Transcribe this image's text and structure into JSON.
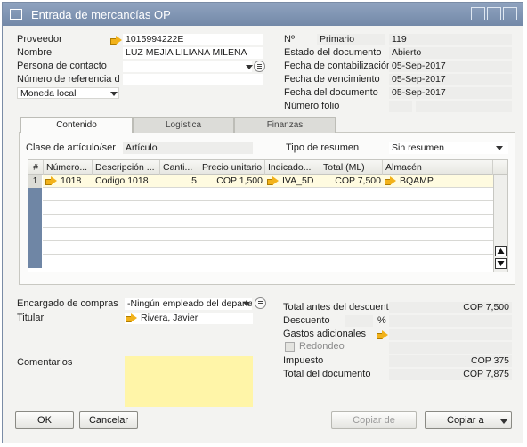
{
  "window": {
    "title": "Entrada de mercancías OP"
  },
  "header_left": {
    "proveedor_label": "Proveedor",
    "proveedor_value": "1015994222E",
    "nombre_label": "Nombre",
    "nombre_value": "LUZ MEJIA LILIANA MILENA",
    "persona_contacto_label": "Persona de contacto",
    "persona_contacto_value": "",
    "numero_referencia_label": "Número de referencia d",
    "numero_referencia_value": "",
    "moneda_value": "Moneda local"
  },
  "header_right": {
    "no_label": "Nº",
    "serie_value": "Primario",
    "no_value": "119",
    "estado_label": "Estado del documento",
    "estado_value": "Abierto",
    "fecha_contab_label": "Fecha de contabilización",
    "fecha_contab_value": "05-Sep-2017",
    "fecha_venc_label": "Fecha de vencimiento",
    "fecha_venc_value": "05-Sep-2017",
    "fecha_doc_label": "Fecha del documento",
    "fecha_doc_value": "05-Sep-2017",
    "numero_folio_label": "Número folio",
    "numero_folio_value": ""
  },
  "tabs": [
    {
      "label": "Contenido",
      "active": true
    },
    {
      "label": "Logística",
      "active": false
    },
    {
      "label": "Finanzas",
      "active": false
    }
  ],
  "contenido": {
    "clase_label": "Clase de artículo/ser",
    "clase_value": "Artículo",
    "tipo_resumen_label": "Tipo de resumen",
    "tipo_resumen_value": "Sin resumen"
  },
  "grid": {
    "columns": [
      "#",
      "Número...",
      "Descripción ...",
      "Canti...",
      "Precio unitario",
      "Indicado...",
      "Total (ML)",
      "Almacén"
    ],
    "rows": [
      {
        "num": "1",
        "numero": "1018",
        "descripcion": "Codigo 1018",
        "cantidad": "5",
        "precio": "COP 1,500",
        "indicador": "IVA_5D",
        "total": "COP 7,500",
        "almacen": "BQAMP"
      }
    ]
  },
  "footer_left": {
    "encargado_label": "Encargado de compras",
    "encargado_value": "-Ningún empleado del departa",
    "titular_label": "Titular",
    "titular_value": "Rivera, Javier",
    "comentarios_label": "Comentarios",
    "comentarios_value": ""
  },
  "totals": {
    "total_antes_label": "Total antes del descuento",
    "total_antes_value": "COP 7,500",
    "descuento_label": "Descuento",
    "descuento_pct": "%",
    "gastos_label": "Gastos adicionales",
    "redondeo_label": "Redondeo",
    "impuesto_label": "Impuesto",
    "impuesto_value": "COP 375",
    "total_doc_label": "Total del documento",
    "total_doc_value": "COP 7,875"
  },
  "buttons": {
    "ok": "OK",
    "cancelar": "Cancelar",
    "copiar_de": "Copiar de",
    "copiar_a": "Copiar a"
  },
  "colors": {
    "titlebar": "#7d92b0",
    "comments_bg": "#fff5a8",
    "link_arrow": "#f2b21a",
    "row_number": "#6f86a5"
  }
}
